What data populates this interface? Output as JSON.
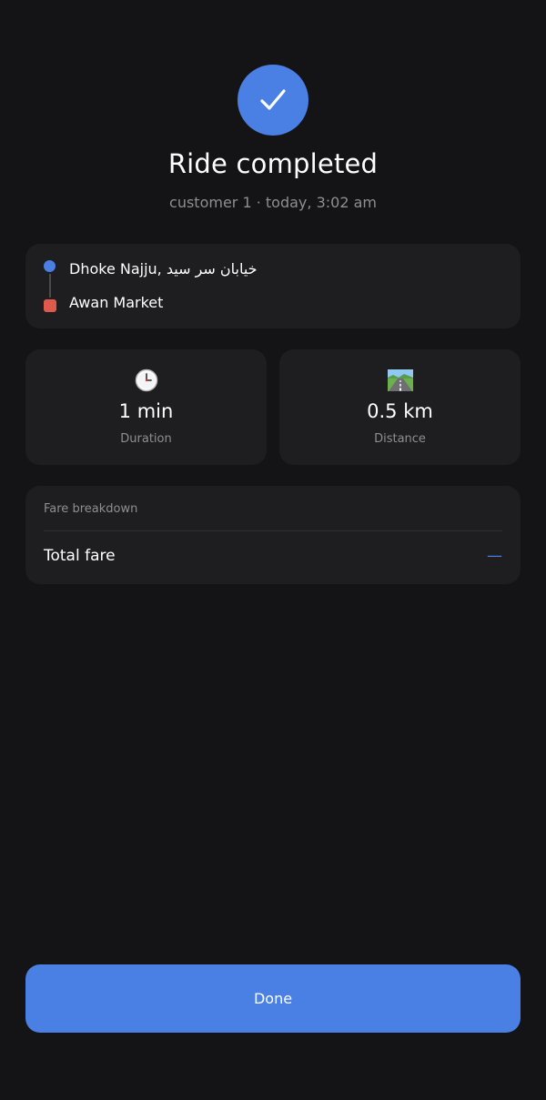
{
  "header": {
    "check_icon": "check-icon",
    "check_color": "#4a7fe3",
    "title": "Ride completed",
    "subtitle": "customer 1 · today, 3:02 am"
  },
  "route": {
    "pickup": "Dhoke Najju, خیابان سر سید",
    "dropoff": "Awan Market",
    "pickup_marker_color": "#4a7fe3",
    "dropoff_marker_color": "#e05a4b"
  },
  "stats": {
    "duration": {
      "icon": "clock-icon",
      "value": "1 min",
      "label": "Duration"
    },
    "distance": {
      "icon": "road-icon",
      "value": "0.5 km",
      "label": "Distance"
    }
  },
  "fare": {
    "heading": "Fare breakdown",
    "total_label": "Total fare",
    "total_value": "—"
  },
  "actions": {
    "done_label": "Done",
    "accent": "#4a7fe3"
  }
}
